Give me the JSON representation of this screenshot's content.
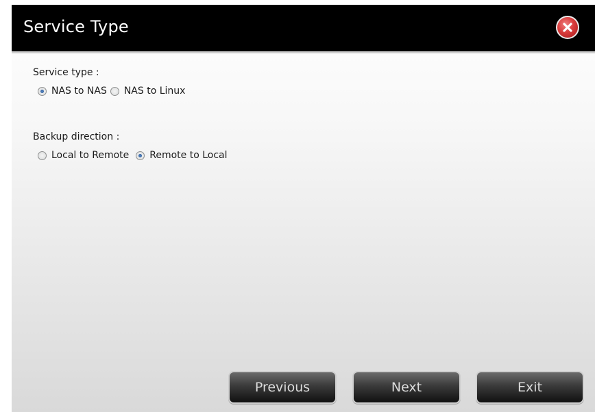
{
  "dialog": {
    "title": "Service Type"
  },
  "service_type": {
    "label": "Service type :",
    "options": [
      {
        "label": "NAS to NAS",
        "selected": true
      },
      {
        "label": "NAS to Linux",
        "selected": false
      }
    ]
  },
  "backup_direction": {
    "label": "Backup direction  :",
    "options": [
      {
        "label": "Local to Remote",
        "selected": false
      },
      {
        "label": "Remote to Local",
        "selected": true
      }
    ]
  },
  "buttons": {
    "previous": "Previous",
    "next": "Next",
    "exit": "Exit"
  },
  "icons": {
    "close": "close-icon"
  },
  "colors": {
    "titlebar": "#000000",
    "close_button": "#d83c3c",
    "radio_selected": "#1f4f8e"
  }
}
